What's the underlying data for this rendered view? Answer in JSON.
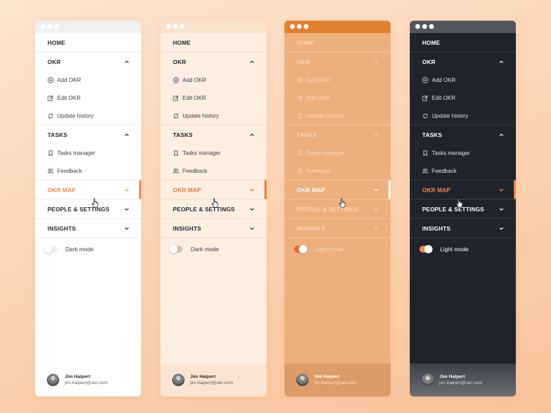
{
  "nav": {
    "home": "HOME",
    "okr": "OKR",
    "add_okr": "Add OKR",
    "edit_okr": "Edit OKR",
    "update_history": "Update history",
    "tasks": "TASKS",
    "tasks_manager": "Tasks manager",
    "feedback": "Feedback",
    "okr_map": "OKR MAP",
    "people_settings": "PEOPLE & SETTINGS",
    "insights": "INSIGHTS"
  },
  "toggle": {
    "dark_mode": "Dark mode",
    "light_mode": "Light mode"
  },
  "user": {
    "name": "Jim Halpert",
    "email": "jim.halpert@okr.com"
  },
  "colors": {
    "accent": "#f0894a",
    "dark_bg": "#1f242c",
    "cream_bg": "#fdeee2",
    "orange_bg": "#edaf7c"
  },
  "panels": [
    {
      "theme": "white",
      "toggle_state": "off",
      "toggle_label": "Dark mode"
    },
    {
      "theme": "cream",
      "toggle_state": "off",
      "toggle_label": "Dark mode"
    },
    {
      "theme": "orange",
      "toggle_state": "on",
      "toggle_label": "Light mode"
    },
    {
      "theme": "dark",
      "toggle_state": "on",
      "toggle_label": "Light mode"
    }
  ]
}
